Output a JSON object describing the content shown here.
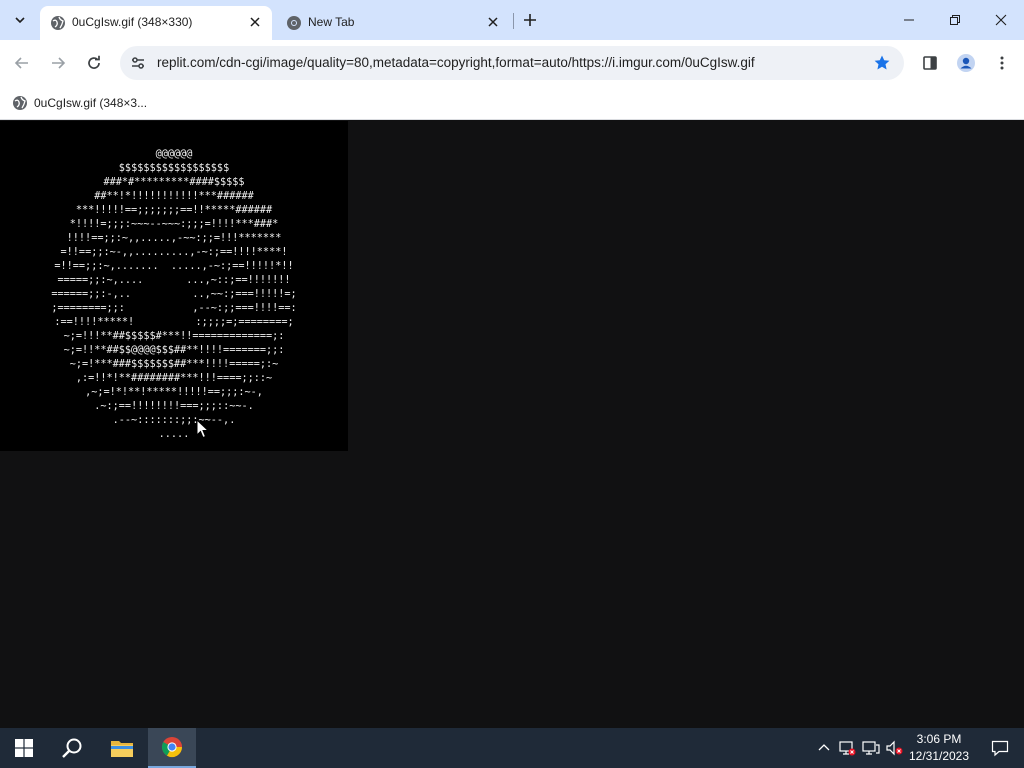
{
  "browser": {
    "tabs": [
      {
        "title": "0uCgIsw.gif (348×330)",
        "active": true
      },
      {
        "title": "New Tab",
        "active": false
      }
    ],
    "url": "replit.com/cdn-cgi/image/quality=80,metadata=copyright,format=auto/https://i.imgur.com/0uCgIsw.gif",
    "bookmark_star_filled": true,
    "accent_color": "#1a73e8"
  },
  "bookmarks": [
    {
      "label": "0uCgIsw.gif (348×3..."
    }
  ],
  "content": {
    "ascii_art": "@@@@@@\n$$$$$$$$$$$$$$$$$$\n###*#*********####$$$$$\n##**!*!!!!!!!!!!!***######\n***!!!!!==;;;;;;;==!!*****######\n*!!!!=;;;:~~~--~~~:;;;=!!!!***###*\n!!!!==;;:~,,.....,-~~:;;=!!!*******\n=!!==;;:~-,,.........,-~:;==!!!!****!\n=!!==;;:~,.......  .....,-~:;==!!!!!*!!\n=====;;:~,....       ...,~::;==!!!!!!!\n======;;:-,..          ..,~~:;===!!!!!=;\n;========;;:           ,--~:;;===!!!!==:\n:==!!!!*****!          :;;;;=;========;\n~;=!!!**##$$$$$#***!!=============;:\n~;=!!**##$$@@@@$$$##**!!!!=======;;:\n~;=!***###$$$$$$$##***!!!!=====;:~\n,:=!!*!**########***!!!====;;::~\n,~;=!*!**!*****!!!!!==;;;:~-,\n.~:;==!!!!!!!!===;;;::~~-.\n.--~:::::::;;:~~--,.\n.....",
    "image_size": "348×330"
  },
  "taskbar": {
    "time": "3:06 PM",
    "date": "12/31/2023",
    "apps": [
      "start-icon",
      "search-icon",
      "file-explorer-icon",
      "chrome-icon"
    ]
  }
}
